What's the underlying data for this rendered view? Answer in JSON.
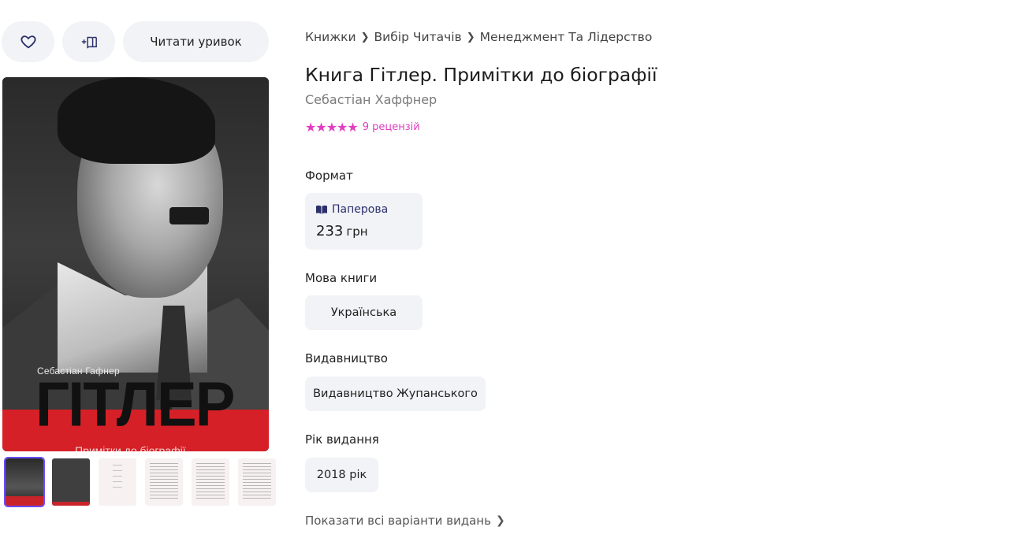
{
  "actions": {
    "like_icon": "heart-icon",
    "shelf_icon": "add-to-shelf-icon",
    "read_excerpt_label": "Читати уривок"
  },
  "cover": {
    "author": "Себастіан Гафнер",
    "title": "ГІТЛЕР",
    "subtitle": "Примітки до біографії"
  },
  "thumbnails": [
    {
      "kind": "cover",
      "active": true
    },
    {
      "kind": "back-cover",
      "active": false
    },
    {
      "kind": "page",
      "active": false
    },
    {
      "kind": "page",
      "active": false
    },
    {
      "kind": "page",
      "active": false
    },
    {
      "kind": "page",
      "active": false
    }
  ],
  "breadcrumb": [
    "Книжки",
    "Вибір Читачів",
    "Менеджмент Та Лідерство"
  ],
  "book": {
    "title": "Книга Гітлер. Примітки до біографії",
    "author": "Себастіан Хаффнер",
    "stars": "★★★★★",
    "reviews": "9 рецензій"
  },
  "format": {
    "label": "Формат",
    "option_name": "Паперова",
    "option_icon": "open-book-icon",
    "price_value": "233",
    "price_currency": "грн"
  },
  "language": {
    "label": "Мова книги",
    "value": "Українська"
  },
  "publisher": {
    "label": "Видавництво",
    "value": "Видавництво Жупанського"
  },
  "year": {
    "label": "Рік видання",
    "value": "2018 рік"
  },
  "show_all_editions": "Показати всі варіанти видань",
  "colors": {
    "accent_rating": "#e23dc1",
    "chip_bg": "#f2f3f6",
    "format_text": "#2b2f6b",
    "cover_red": "#d62027"
  }
}
